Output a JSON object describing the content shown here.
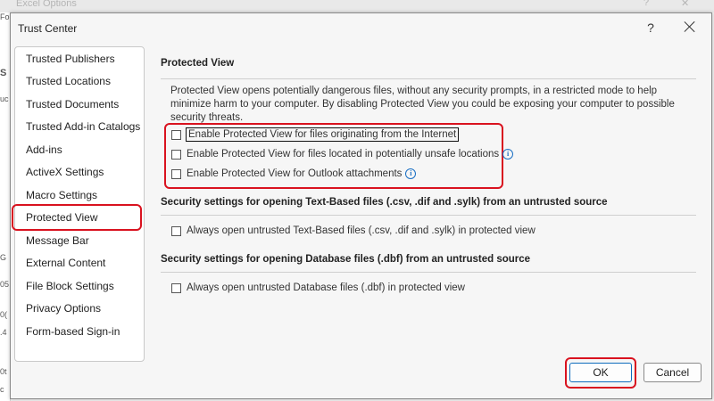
{
  "background": {
    "window_title": "Excel Options",
    "help_glyph": "?",
    "sheet_fragments": [
      "Fo",
      "S",
      "uc",
      "G",
      "05",
      "0(",
      ".4",
      "0t",
      "c"
    ]
  },
  "dialog": {
    "title": "Trust Center",
    "help_glyph": "?"
  },
  "sidebar": {
    "items": [
      {
        "label": "Trusted Publishers"
      },
      {
        "label": "Trusted Locations"
      },
      {
        "label": "Trusted Documents"
      },
      {
        "label": "Trusted Add-in Catalogs"
      },
      {
        "label": "Add-ins"
      },
      {
        "label": "ActiveX Settings"
      },
      {
        "label": "Macro Settings"
      },
      {
        "label": "Protected View",
        "selected": true
      },
      {
        "label": "Message Bar"
      },
      {
        "label": "External Content"
      },
      {
        "label": "File Block Settings"
      },
      {
        "label": "Privacy Options"
      },
      {
        "label": "Form-based Sign-in"
      }
    ]
  },
  "protected_view": {
    "heading": "Protected View",
    "description": "Protected View opens potentially dangerous files, without any security prompts, in a restricted mode to help minimize harm to your computer. By disabling Protected View you could be exposing your computer to possible security threats.",
    "options": [
      {
        "label": "Enable Protected View for files originating from the Internet",
        "checked": false,
        "focused": true,
        "info": false
      },
      {
        "label": "Enable Protected View for files located in potentially unsafe locations",
        "checked": false,
        "info": true
      },
      {
        "label": "Enable Protected View for Outlook attachments",
        "checked": false,
        "info": true
      }
    ]
  },
  "text_based": {
    "heading": "Security settings for opening Text-Based files (.csv, .dif and .sylk) from an untrusted source",
    "option": {
      "label": "Always open untrusted Text-Based files (.csv, .dif and .sylk) in protected view",
      "checked": false
    }
  },
  "database": {
    "heading": "Security settings for opening Database files (.dbf) from an untrusted source",
    "option": {
      "label": "Always open untrusted Database files (.dbf) in protected view",
      "checked": false
    }
  },
  "footer": {
    "ok_label": "OK",
    "cancel_label": "Cancel"
  },
  "icons": {
    "info_glyph": "i"
  },
  "colors": {
    "annotation_red": "#d9121f",
    "info_blue": "#1a6fc4",
    "ok_border": "#0f6cbd"
  }
}
